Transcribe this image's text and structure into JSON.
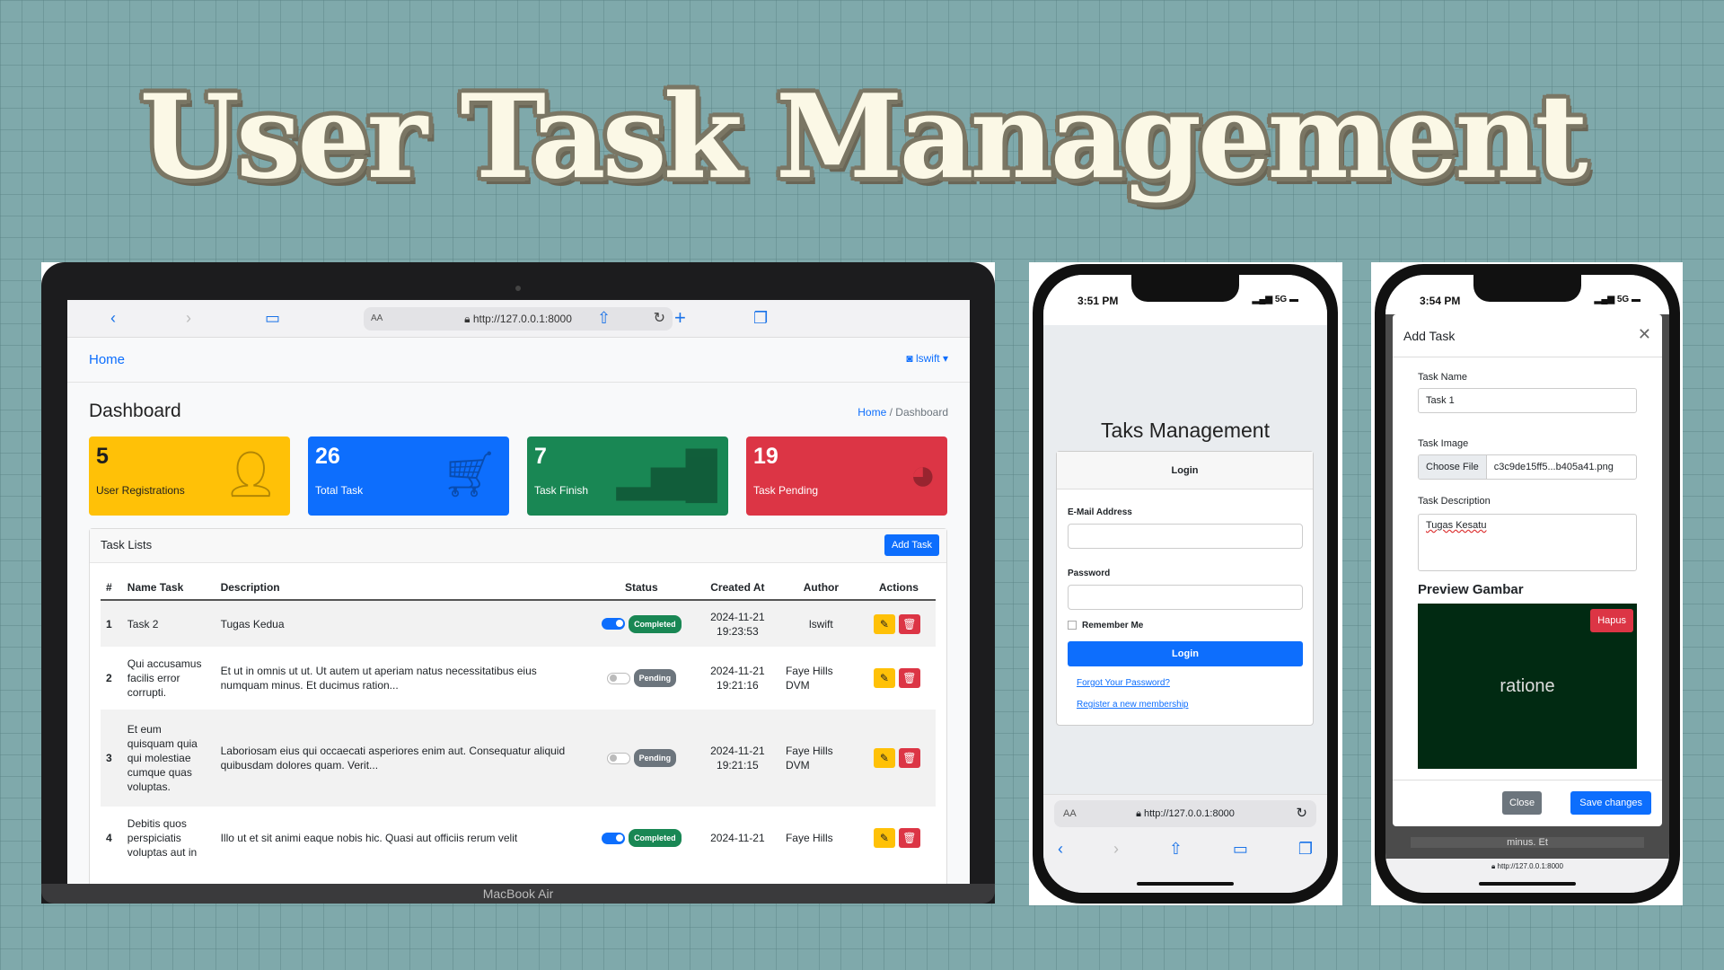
{
  "hero_title": "User Task Management",
  "laptop": {
    "brand": "MacBook Air",
    "browser": {
      "aa": "AA",
      "url": "http://127.0.0.1:8000"
    },
    "nav": {
      "home": "Home",
      "user": "lswift"
    },
    "page_title": "Dashboard",
    "breadcrumb": {
      "home": "Home",
      "sep": "/",
      "current": "Dashboard"
    },
    "cards": [
      {
        "value": "5",
        "label": "User Registrations",
        "icon": "user-plus-icon"
      },
      {
        "value": "26",
        "label": "Total Task",
        "icon": "cart-icon"
      },
      {
        "value": "7",
        "label": "Task Finish",
        "icon": "bar-chart-icon"
      },
      {
        "value": "19",
        "label": "Task Pending",
        "icon": "pie-chart-icon"
      }
    ],
    "task_list": {
      "title": "Task Lists",
      "add_button": "Add Task",
      "headers": [
        "#",
        "Name Task",
        "Description",
        "Status",
        "Created At",
        "Author",
        "Actions"
      ],
      "rows": [
        {
          "no": "1",
          "name": "Task 2",
          "desc": "Tugas Kedua",
          "toggle": "on",
          "status": "Completed",
          "date": "2024-11-21",
          "time": "19:23:53",
          "author": "lswift"
        },
        {
          "no": "2",
          "name": "Qui accusamus facilis error corrupti.",
          "desc": "Et ut in omnis ut ut. Ut autem ut aperiam natus necessitatibus eius numquam minus. Et ducimus ration...",
          "toggle": "off",
          "status": "Pending",
          "date": "2024-11-21",
          "time": "19:21:16",
          "author": "Faye Hills DVM"
        },
        {
          "no": "3",
          "name": "Et eum quisquam quia qui molestiae cumque quas voluptas.",
          "desc": "Laboriosam eius qui occaecati asperiores enim aut. Consequatur aliquid quibusdam dolores quam. Verit...",
          "toggle": "off",
          "status": "Pending",
          "date": "2024-11-21",
          "time": "19:21:15",
          "author": "Faye Hills DVM"
        },
        {
          "no": "4",
          "name": "Debitis quos perspiciatis voluptas aut in",
          "desc": "Illo ut et sit animi eaque nobis hic. Quasi aut officiis rerum velit",
          "toggle": "on",
          "status": "Completed",
          "date": "2024-11-21",
          "time": "",
          "author": "Faye Hills"
        }
      ]
    }
  },
  "phone1": {
    "time": "3:51 PM",
    "signal": "5G",
    "title": "Taks Management",
    "login": {
      "header": "Login",
      "email_label": "E-Mail Address",
      "password_label": "Password",
      "remember": "Remember Me",
      "button": "Login",
      "forgot": "Forgot Your Password?",
      "register": "Register a new membership"
    },
    "browser": {
      "aa": "AA",
      "url": "http://127.0.0.1:8000"
    }
  },
  "phone2": {
    "time": "3:54 PM",
    "signal": "5G",
    "modal": {
      "title": "Add Task",
      "name_label": "Task Name",
      "name_value": "Task 1",
      "image_label": "Task Image",
      "choose_file": "Choose File",
      "file_name": "c3c9de15ff5...b405a41.png",
      "desc_label": "Task Description",
      "desc_value": "Tugas Kesatu",
      "preview_label": "Preview Gambar",
      "preview_text": "ratione",
      "delete_button": "Hapus",
      "close_button": "Close",
      "save_button": "Save changes"
    },
    "behind_text": "minus. Et",
    "url": "http://127.0.0.1:8000"
  }
}
